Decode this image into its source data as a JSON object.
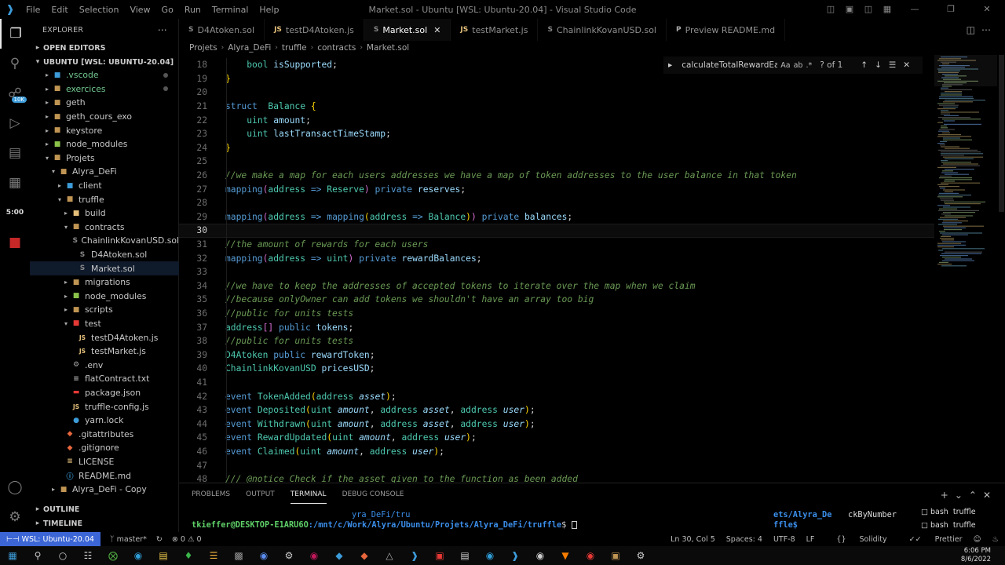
{
  "titlebar": {
    "menu": [
      "File",
      "Edit",
      "Selection",
      "View",
      "Go",
      "Run",
      "Terminal",
      "Help"
    ],
    "title": "Market.sol - Ubuntu [WSL: Ubuntu-20.04] - Visual Studio Code"
  },
  "activity": {
    "badge": "10K",
    "timer": "5:00"
  },
  "sidebar": {
    "header": "EXPLORER",
    "open_editors": "OPEN EDITORS",
    "workspace": "UBUNTU [WSL: UBUNTU-20.04]",
    "outline": "OUTLINE",
    "timeline": "TIMELINE",
    "tree": [
      {
        "label": ".vscode",
        "depth": 1,
        "kind": "folder",
        "color": "#3c9bd8"
      },
      {
        "label": "exercices",
        "depth": 1,
        "kind": "folder",
        "color": "#c09553"
      },
      {
        "label": "geth",
        "depth": 1,
        "kind": "folder",
        "color": "#c09553"
      },
      {
        "label": "geth_cours_exo",
        "depth": 1,
        "kind": "folder",
        "color": "#c09553"
      },
      {
        "label": "keystore",
        "depth": 1,
        "kind": "folder",
        "color": "#c09553"
      },
      {
        "label": "node_modules",
        "depth": 1,
        "kind": "folder",
        "color": "#8bc34a"
      },
      {
        "label": "Projets",
        "depth": 1,
        "kind": "folder-open",
        "color": "#c09553"
      },
      {
        "label": "Alyra_DeFi",
        "depth": 2,
        "kind": "folder-open",
        "color": "#c09553"
      },
      {
        "label": "client",
        "depth": 3,
        "kind": "folder",
        "color": "#3c9bd8"
      },
      {
        "label": "truffle",
        "depth": 3,
        "kind": "folder-open",
        "color": "#c09553"
      },
      {
        "label": "build",
        "depth": 4,
        "kind": "folder",
        "color": "#e5c07b"
      },
      {
        "label": "contracts",
        "depth": 4,
        "kind": "folder-open",
        "color": "#c09553"
      },
      {
        "label": "ChainlinkKovanUSD.sol",
        "depth": 5,
        "kind": "file",
        "color": "#888"
      },
      {
        "label": "D4Atoken.sol",
        "depth": 5,
        "kind": "file",
        "color": "#888"
      },
      {
        "label": "Market.sol",
        "depth": 5,
        "kind": "file",
        "color": "#888"
      },
      {
        "label": "migrations",
        "depth": 4,
        "kind": "folder",
        "color": "#c09553"
      },
      {
        "label": "node_modules",
        "depth": 4,
        "kind": "folder",
        "color": "#8bc34a"
      },
      {
        "label": "scripts",
        "depth": 4,
        "kind": "folder",
        "color": "#c09553"
      },
      {
        "label": "test",
        "depth": 4,
        "kind": "folder-open",
        "color": "#e53935"
      },
      {
        "label": "testD4Atoken.js",
        "depth": 5,
        "kind": "js",
        "color": "#e5c07b"
      },
      {
        "label": "testMarket.js",
        "depth": 5,
        "kind": "js",
        "color": "#e5c07b"
      },
      {
        "label": ".env",
        "depth": 4,
        "kind": "gear",
        "color": "#aaa"
      },
      {
        "label": "flatContract.txt",
        "depth": 4,
        "kind": "text",
        "color": "#aaa"
      },
      {
        "label": "package.json",
        "depth": 4,
        "kind": "npm",
        "color": "#e53935"
      },
      {
        "label": "truffle-config.js",
        "depth": 4,
        "kind": "js",
        "color": "#e5c07b"
      },
      {
        "label": "yarn.lock",
        "depth": 4,
        "kind": "yarn",
        "color": "#3c9bd8"
      },
      {
        "label": ".gitattributes",
        "depth": 3,
        "kind": "git",
        "color": "#e8663d"
      },
      {
        "label": ".gitignore",
        "depth": 3,
        "kind": "git",
        "color": "#e8663d"
      },
      {
        "label": "LICENSE",
        "depth": 3,
        "kind": "license",
        "color": "#e5c07b"
      },
      {
        "label": "README.md",
        "depth": 3,
        "kind": "info",
        "color": "#3c9bd8"
      },
      {
        "label": "Alyra_DeFi - Copy",
        "depth": 2,
        "kind": "folder",
        "color": "#c09553"
      }
    ]
  },
  "tabs": [
    {
      "label": "D4Atoken.sol",
      "icon": "S",
      "color": "#888"
    },
    {
      "label": "testD4Atoken.js",
      "icon": "JS",
      "color": "#e5c07b"
    },
    {
      "label": "Market.sol",
      "icon": "S",
      "color": "#888",
      "active": true
    },
    {
      "label": "testMarket.js",
      "icon": "JS",
      "color": "#e5c07b"
    },
    {
      "label": "ChainlinkKovanUSD.sol",
      "icon": "S",
      "color": "#888"
    },
    {
      "label": "Preview README.md",
      "icon": "P",
      "color": "#aaa"
    }
  ],
  "breadcrumb": [
    "Projets",
    "Alyra_DeFi",
    "truffle",
    "contracts",
    "Market.sol"
  ],
  "find": {
    "query": "calculateTotalRewardEarne",
    "count": "? of 1"
  },
  "editor": {
    "lines": [
      {
        "n": "18",
        "html": "    <span class='t'>bool</span> <span class='v'>isSupported</span>;"
      },
      {
        "n": "19",
        "html": "<span class='p'>}</span>"
      },
      {
        "n": "20",
        "html": ""
      },
      {
        "n": "21",
        "html": "<span class='k'>struct</span>  <span class='t'>Balance</span> <span class='p'>{</span>"
      },
      {
        "n": "22",
        "html": "    <span class='t'>uint</span> <span class='v'>amount</span>;"
      },
      {
        "n": "23",
        "html": "    <span class='t'>uint</span> <span class='v'>lastTransactTimeStamp</span>;"
      },
      {
        "n": "24",
        "html": "<span class='p'>}</span>"
      },
      {
        "n": "25",
        "html": ""
      },
      {
        "n": "26",
        "html": "<span class='c'>//we make a map for each users addresses we have a map of token addresses to the user balance in that token</span>"
      },
      {
        "n": "27",
        "html": "<span class='k'>mapping</span><span class='p2'>(</span><span class='t'>address</span> <span class='k'>=&gt;</span> <span class='t'>Reserve</span><span class='p2'>)</span> <span class='k'>private</span> <span class='v'>reserves</span>;"
      },
      {
        "n": "28",
        "html": ""
      },
      {
        "n": "29",
        "html": "<span class='k'>mapping</span><span class='p2'>(</span><span class='t'>address</span> <span class='k'>=&gt;</span> <span class='k'>mapping</span><span class='p'>(</span><span class='t'>address</span> <span class='k'>=&gt;</span> <span class='t'>Balance</span><span class='p'>)</span><span class='p2'>)</span> <span class='k'>private</span> <span class='v'>balances</span>;"
      },
      {
        "n": "30",
        "html": "",
        "current": true
      },
      {
        "n": "31",
        "html": "<span class='c'>//the amount of rewards for each users</span>"
      },
      {
        "n": "32",
        "html": "<span class='k'>mapping</span><span class='p2'>(</span><span class='t'>address</span> <span class='k'>=&gt;</span> <span class='t'>uint</span><span class='p2'>)</span> <span class='k'>private</span> <span class='v'>rewardBalances</span>;"
      },
      {
        "n": "33",
        "html": ""
      },
      {
        "n": "34",
        "html": "<span class='c'>//we have to keep the addresses of accepted tokens to iterate over the map when we claim</span>"
      },
      {
        "n": "35",
        "html": "<span class='c'>//because onlyOwner can add tokens we shouldn't have an array too big</span>"
      },
      {
        "n": "36",
        "html": "<span class='c'>//public for units tests</span>"
      },
      {
        "n": "37",
        "html": "<span class='t'>address</span><span class='p2'>[]</span> <span class='k'>public</span> <span class='v'>tokens</span>;"
      },
      {
        "n": "38",
        "html": "<span class='c'>//public for units tests</span>"
      },
      {
        "n": "39",
        "html": "<span class='t'>D4Atoken</span> <span class='k'>public</span> <span class='v'>rewardToken</span>;"
      },
      {
        "n": "40",
        "html": "<span class='t'>ChainlinkKovanUSD</span> <span class='v'>pricesUSD</span>;"
      },
      {
        "n": "41",
        "html": ""
      },
      {
        "n": "42",
        "html": "<span class='k'>event</span> <span class='t'>TokenAdded</span><span class='p'>(</span><span class='t'>address</span> <span class='i'>asset</span><span class='p'>)</span>;"
      },
      {
        "n": "43",
        "html": "<span class='k'>event</span> <span class='t'>Deposited</span><span class='p'>(</span><span class='t'>uint</span> <span class='i'>amount</span>, <span class='t'>address</span> <span class='i'>asset</span>, <span class='t'>address</span> <span class='i'>user</span><span class='p'>)</span>;"
      },
      {
        "n": "44",
        "html": "<span class='k'>event</span> <span class='t'>Withdrawn</span><span class='p'>(</span><span class='t'>uint</span> <span class='i'>amount</span>, <span class='t'>address</span> <span class='i'>asset</span>, <span class='t'>address</span> <span class='i'>user</span><span class='p'>)</span>;"
      },
      {
        "n": "45",
        "html": "<span class='k'>event</span> <span class='t'>RewardUpdated</span><span class='p'>(</span><span class='t'>uint</span> <span class='i'>amount</span>, <span class='t'>address</span> <span class='i'>user</span><span class='p'>)</span>;"
      },
      {
        "n": "46",
        "html": "<span class='k'>event</span> <span class='t'>Claimed</span><span class='p'>(</span><span class='t'>uint</span> <span class='i'>amount</span>, <span class='t'>address</span> <span class='i'>user</span><span class='p'>)</span>;"
      },
      {
        "n": "47",
        "html": ""
      },
      {
        "n": "48",
        "html": "<span class='c'>/// @notice Check if the asset given to the function as been added</span>"
      }
    ]
  },
  "panel": {
    "tabs": [
      "PROBLEMS",
      "OUTPUT",
      "TERMINAL",
      "DEBUG CONSOLE"
    ],
    "active_tab": "TERMINAL",
    "term_partial": "yra_DeFi/tru",
    "prompt_user": "tkieffer@DESKTOP-E1ARU6O",
    "prompt_path": ":/mnt/c/Work/Alyra/Ubuntu/Projets/Alyra_DeFi/truffle",
    "prompt_end": "$",
    "split1_line1": "ets/Alyra_De",
    "split1_line2": "ffle$",
    "split2_line1": "ckByNumber",
    "terminals": [
      "bash  truffle",
      "bash  truffle"
    ]
  },
  "status": {
    "remote": "WSL: Ubuntu-20.04",
    "branch": "master*",
    "errors": "0",
    "warnings": "0",
    "position": "Ln 30, Col 5",
    "spaces": "Spaces: 4",
    "encoding": "UTF-8",
    "eol": "LF",
    "language": "Solidity",
    "formatter": "Prettier"
  },
  "taskbar": {
    "time": "6:06 PM",
    "date": "8/6/2022"
  }
}
